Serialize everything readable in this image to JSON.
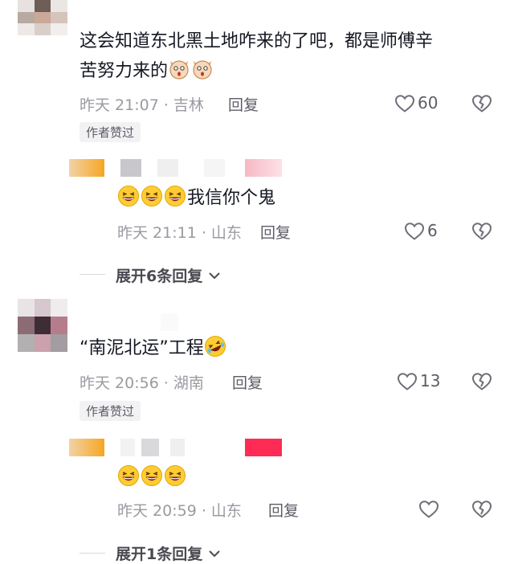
{
  "comments": [
    {
      "text": "这会知道东北黑土地咋来的了吧，都是师傅辛",
      "text_line2": "苦努力来的",
      "time_location": "昨天 21:07 · 吉林",
      "reply_label": "回复",
      "like_count": "60",
      "badge": "作者赞过",
      "reply": {
        "text": "我信你个鬼",
        "time_location": "昨天 21:11 · 山东",
        "reply_label": "回复",
        "like_count": "6"
      },
      "expand_label": "展开6条回复"
    },
    {
      "text_open": "“南泥北运”",
      "text_rest": "工程",
      "time_location": "昨天 20:56 · 湖南",
      "reply_label": "回复",
      "like_count": "13",
      "badge": "作者赞过",
      "reply": {
        "time_location": "昨天 20:59 · 山东",
        "reply_label": "回复",
        "like_count": ""
      },
      "expand_label": "展开1条回复"
    }
  ],
  "icons": {
    "like": "heart-outline-icon",
    "dislike": "broken-heart-icon",
    "expand": "chevron-down-icon",
    "emoji_cat": "surprised-cat-emoji",
    "emoji_laugh": "laughing-emoji",
    "emoji_rofl": "rolling-laughing-emoji"
  },
  "colors": {
    "text": "#161823",
    "meta": "#9a9aa1",
    "accent_pink": "#fe2c55"
  }
}
